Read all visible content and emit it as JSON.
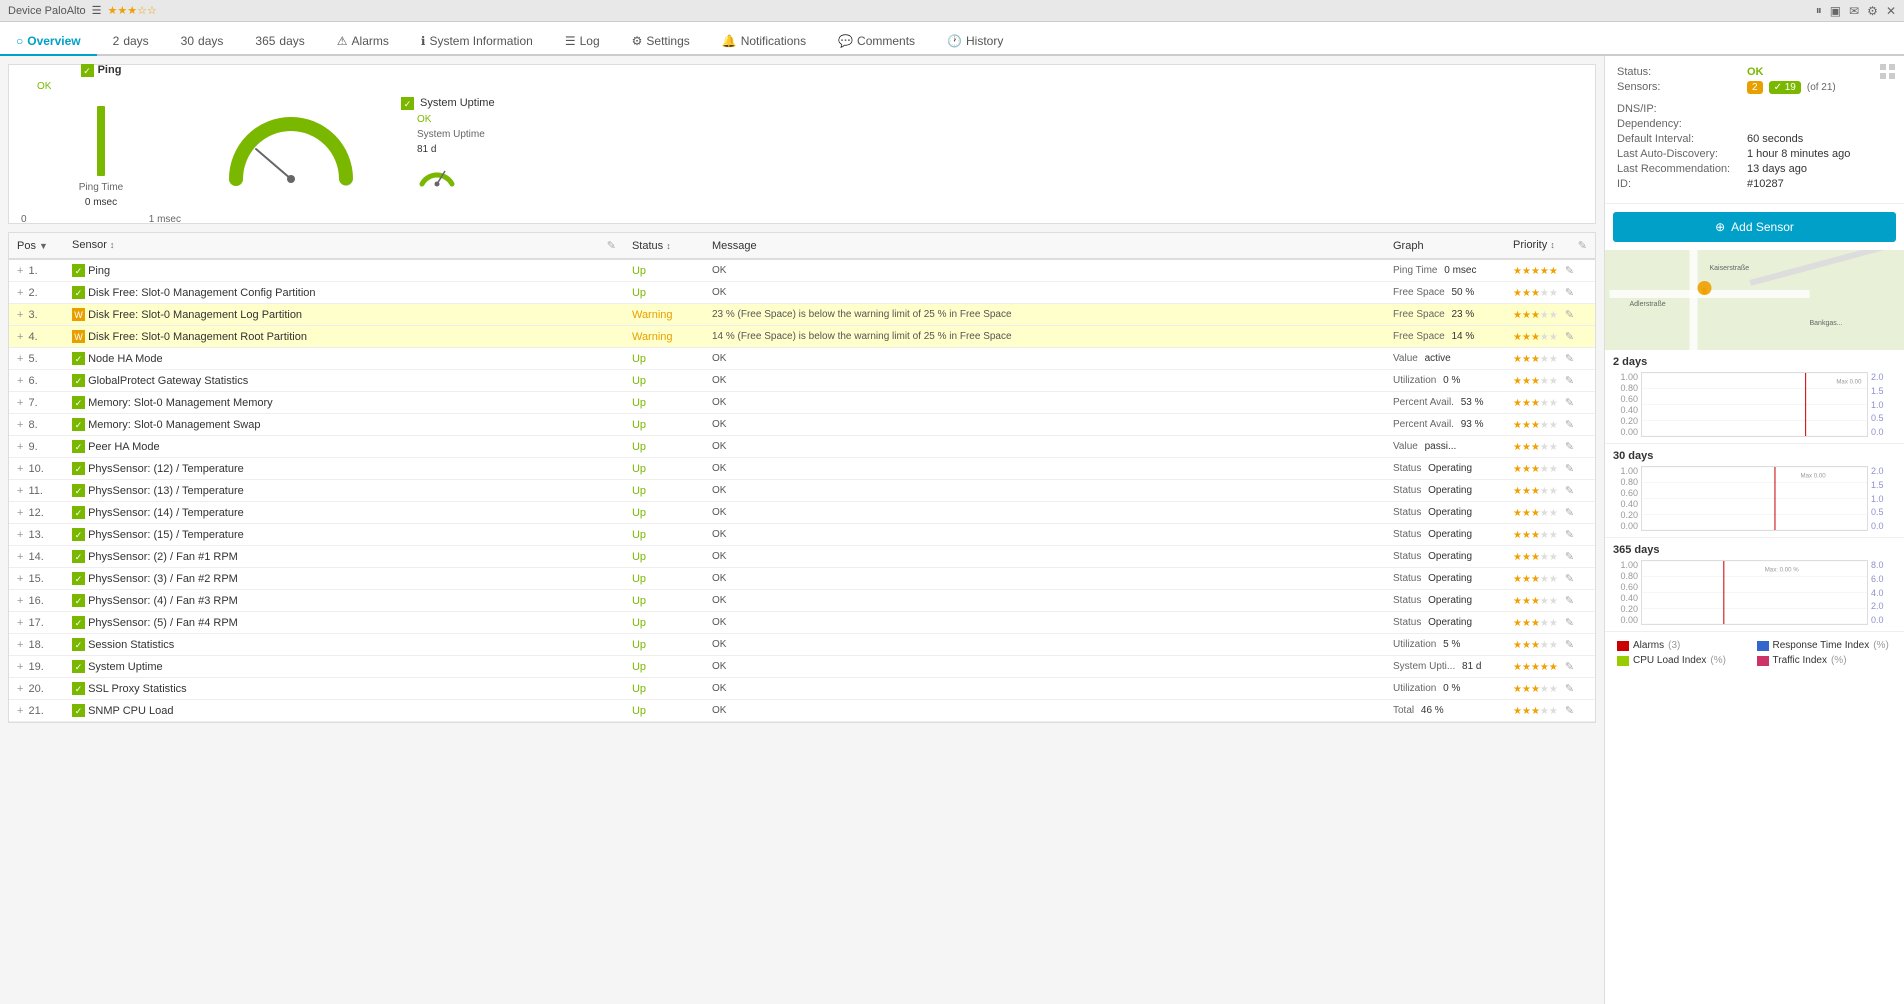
{
  "topbar": {
    "device_label": "Device PaloAlto",
    "stars": "★★★☆☆",
    "icons": [
      "pause",
      "monitor",
      "mail",
      "settings",
      "close"
    ]
  },
  "nav": {
    "tabs": [
      {
        "label": "Overview",
        "icon": "○",
        "active": true
      },
      {
        "label": "2 days"
      },
      {
        "label": "30 days"
      },
      {
        "label": "365 days"
      },
      {
        "label": "Alarms",
        "icon": "⚠"
      },
      {
        "label": "System Information",
        "icon": "ℹ"
      },
      {
        "label": "Log",
        "icon": "☰"
      },
      {
        "label": "Settings",
        "icon": "⚙"
      },
      {
        "label": "Notifications",
        "icon": "🔔"
      },
      {
        "label": "Comments",
        "icon": "💬"
      },
      {
        "label": "History",
        "icon": "🕐"
      }
    ]
  },
  "overview": {
    "ping": {
      "label": "Ping",
      "status": "OK",
      "time_label": "Ping Time",
      "time_value": "0 msec",
      "scale_min": "0",
      "scale_max": "1 msec"
    },
    "uptime": {
      "label": "System Uptime",
      "status": "OK",
      "value": "System Uptime",
      "value2": "81 d"
    }
  },
  "info_panel": {
    "status_label": "Status:",
    "status_value": "OK",
    "sensors_label": "Sensors:",
    "sensors_warning": "2",
    "sensors_ok": "19",
    "sensors_total": "(of 21)",
    "dns_label": "DNS/IP:",
    "dns_value": "",
    "dependency_label": "Dependency:",
    "dependency_value": "",
    "default_interval_label": "Default Interval:",
    "default_interval_value": "60 seconds",
    "last_autodiscovery_label": "Last Auto-Discovery:",
    "last_autodiscovery_value": "1 hour 8 minutes ago",
    "last_recommendation_label": "Last Recommendation:",
    "last_recommendation_value": "13 days ago",
    "id_label": "ID:",
    "id_value": "#10287",
    "add_sensor_btn": "Add Sensor"
  },
  "charts": {
    "days2_label": "2 days",
    "days30_label": "30 days",
    "days365_label": "365 days",
    "y_labels": [
      "1.00",
      "0.80",
      "0.60",
      "0.40",
      "0.20",
      "0.00"
    ],
    "y_labels_right": [
      "2.0",
      "1.5",
      "1.0",
      "0.5",
      "0.0"
    ]
  },
  "legend": {
    "items": [
      {
        "color": "#cc0000",
        "label": "Alarms",
        "unit": "(3)"
      },
      {
        "color": "#3366cc",
        "label": "Response Time Index",
        "unit": "(%)"
      },
      {
        "color": "#99cc00",
        "label": "CPU Load Index",
        "unit": "(%)"
      },
      {
        "color": "#cc3366",
        "label": "Traffic Index",
        "unit": "(%)"
      }
    ]
  },
  "table": {
    "headers": {
      "pos": "Pos",
      "sensor": "Sensor",
      "status": "Status",
      "message": "Message",
      "graph": "Graph",
      "priority": "Priority"
    },
    "rows": [
      {
        "pos": "1.",
        "name": "Ping",
        "status": "Up",
        "message": "OK",
        "graph_label": "Ping Time",
        "graph_value": "0 msec",
        "stars": 5,
        "icon": "green"
      },
      {
        "pos": "2.",
        "name": "Disk Free: Slot-0 Management Config Partition",
        "status": "Up",
        "message": "OK",
        "graph_label": "Free Space",
        "graph_value": "50 %",
        "stars": 3,
        "icon": "green"
      },
      {
        "pos": "3.",
        "name": "Disk Free: Slot-0 Management Log Partition",
        "status": "Warning",
        "message": "23 % (Free Space) is below the warning limit of 25 % in Free Space",
        "graph_label": "Free Space",
        "graph_value": "23 %",
        "stars": 3,
        "icon": "warning",
        "row_class": "warning-row"
      },
      {
        "pos": "4.",
        "name": "Disk Free: Slot-0 Management Root Partition",
        "status": "Warning",
        "message": "14 % (Free Space) is below the warning limit of 25 % in Free Space",
        "graph_label": "Free Space",
        "graph_value": "14 %",
        "stars": 3,
        "icon": "warning",
        "row_class": "warning-row"
      },
      {
        "pos": "5.",
        "name": "Node HA Mode",
        "status": "Up",
        "message": "OK",
        "graph_label": "Value",
        "graph_value": "active",
        "stars": 3,
        "icon": "green"
      },
      {
        "pos": "6.",
        "name": "GlobalProtect Gateway Statistics",
        "status": "Up",
        "message": "OK",
        "graph_label": "Utilization",
        "graph_value": "0 %",
        "stars": 3,
        "icon": "green"
      },
      {
        "pos": "7.",
        "name": "Memory: Slot-0 Management Memory",
        "status": "Up",
        "message": "OK",
        "graph_label": "Percent Avail.",
        "graph_value": "53 %",
        "stars": 3,
        "icon": "green"
      },
      {
        "pos": "8.",
        "name": "Memory: Slot-0 Management Swap",
        "status": "Up",
        "message": "OK",
        "graph_label": "Percent Avail.",
        "graph_value": "93 %",
        "stars": 3,
        "icon": "green"
      },
      {
        "pos": "9.",
        "name": "Peer HA Mode",
        "status": "Up",
        "message": "OK",
        "graph_label": "Value",
        "graph_value": "passi...",
        "stars": 3,
        "icon": "green"
      },
      {
        "pos": "10.",
        "name": "PhysSensor: (12) / Temperature",
        "status": "Up",
        "message": "OK",
        "graph_label": "Status",
        "graph_value": "Operating",
        "stars": 3,
        "icon": "green"
      },
      {
        "pos": "11.",
        "name": "PhysSensor: (13) / Temperature",
        "status": "Up",
        "message": "OK",
        "graph_label": "Status",
        "graph_value": "Operating",
        "stars": 3,
        "icon": "green"
      },
      {
        "pos": "12.",
        "name": "PhysSensor: (14) / Temperature",
        "status": "Up",
        "message": "OK",
        "graph_label": "Status",
        "graph_value": "Operating",
        "stars": 3,
        "icon": "green"
      },
      {
        "pos": "13.",
        "name": "PhysSensor: (15) / Temperature",
        "status": "Up",
        "message": "OK",
        "graph_label": "Status",
        "graph_value": "Operating",
        "stars": 3,
        "icon": "green"
      },
      {
        "pos": "14.",
        "name": "PhysSensor: (2) / Fan #1 RPM",
        "status": "Up",
        "message": "OK",
        "graph_label": "Status",
        "graph_value": "Operating",
        "stars": 3,
        "icon": "green"
      },
      {
        "pos": "15.",
        "name": "PhysSensor: (3) / Fan #2 RPM",
        "status": "Up",
        "message": "OK",
        "graph_label": "Status",
        "graph_value": "Operating",
        "stars": 3,
        "icon": "green"
      },
      {
        "pos": "16.",
        "name": "PhysSensor: (4) / Fan #3 RPM",
        "status": "Up",
        "message": "OK",
        "graph_label": "Status",
        "graph_value": "Operating",
        "stars": 3,
        "icon": "green"
      },
      {
        "pos": "17.",
        "name": "PhysSensor: (5) / Fan #4 RPM",
        "status": "Up",
        "message": "OK",
        "graph_label": "Status",
        "graph_value": "Operating",
        "stars": 3,
        "icon": "green"
      },
      {
        "pos": "18.",
        "name": "Session Statistics",
        "status": "Up",
        "message": "OK",
        "graph_label": "Utilization",
        "graph_value": "5 %",
        "stars": 3,
        "icon": "green"
      },
      {
        "pos": "19.",
        "name": "System Uptime",
        "status": "Up",
        "message": "OK",
        "graph_label": "System Upti...",
        "graph_value": "81 d",
        "stars": 5,
        "icon": "green"
      },
      {
        "pos": "20.",
        "name": "SSL Proxy Statistics",
        "status": "Up",
        "message": "OK",
        "graph_label": "Utilization",
        "graph_value": "0 %",
        "stars": 3,
        "icon": "green"
      },
      {
        "pos": "21.",
        "name": "SNMP CPU Load",
        "status": "Up",
        "message": "OK",
        "graph_label": "Total",
        "graph_value": "46 %",
        "stars": 3,
        "icon": "green"
      }
    ]
  }
}
